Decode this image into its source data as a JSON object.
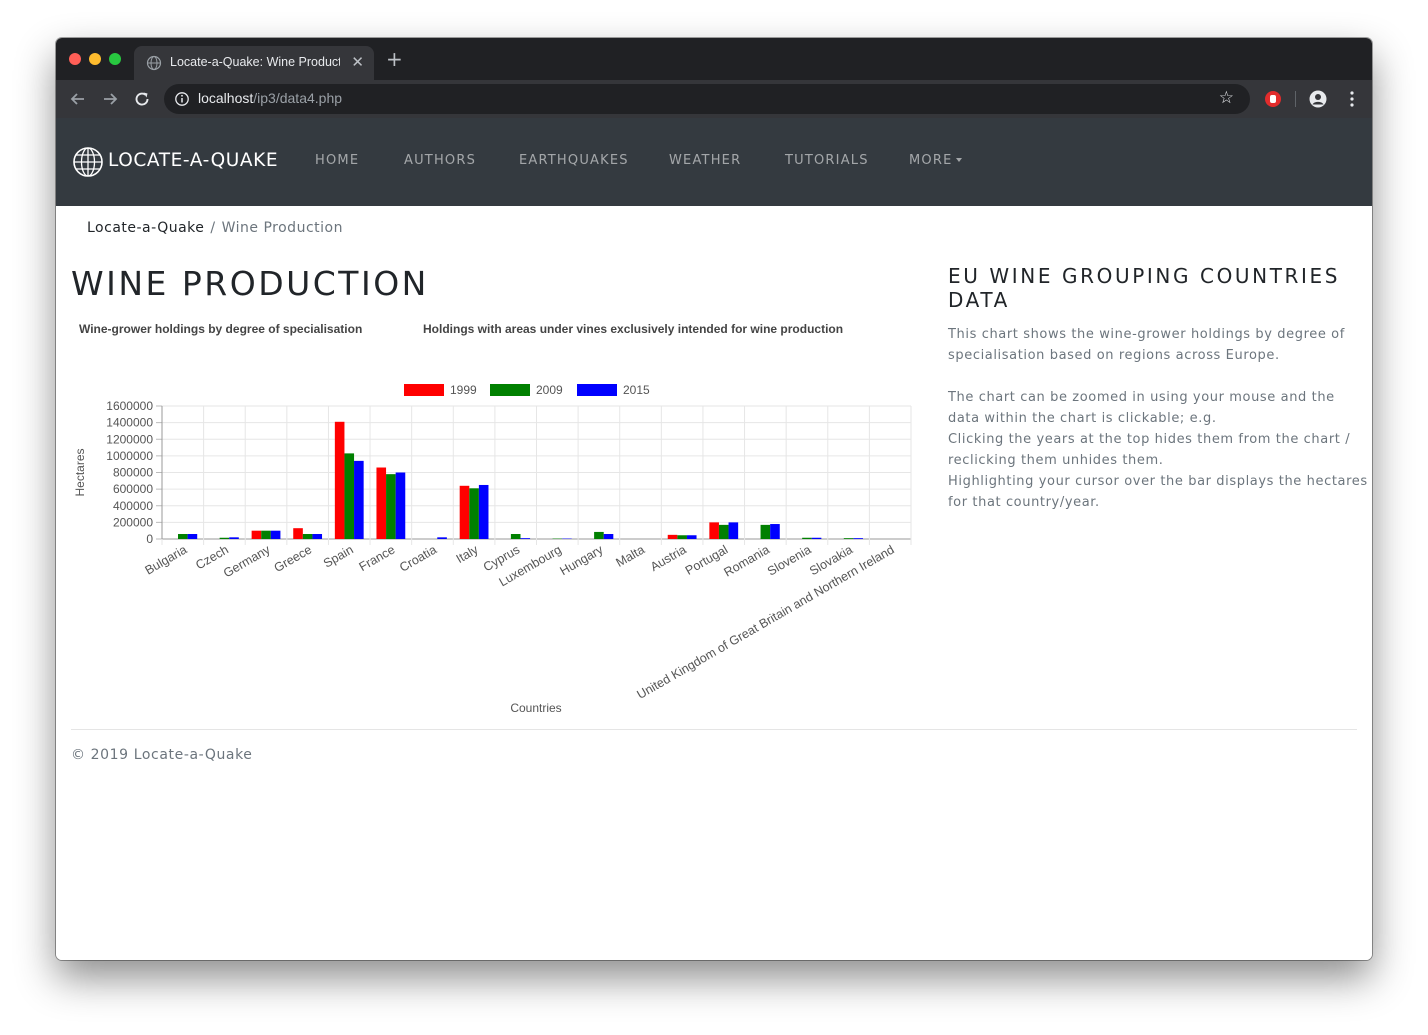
{
  "browser": {
    "tab_title": "Locate-a-Quake: Wine Production",
    "url_host": "localhost",
    "url_path": "/ip3/data4.php"
  },
  "navbar": {
    "brand": "LOCATE-A-QUAKE",
    "links": [
      "HOME",
      "AUTHORS",
      "EARTHQUAKES",
      "WEATHER",
      "TUTORIALS",
      "MORE"
    ]
  },
  "breadcrumb": {
    "home": "Locate-a-Quake",
    "separator": "/",
    "current": "Wine Production"
  },
  "page": {
    "title": "WINE PRODUCTION"
  },
  "chart_data": {
    "type": "bar",
    "title": "Wine-grower holdings by degree of specialisation",
    "subtitle": "Holdings with areas under vines exclusively intended for wine production",
    "xlabel": "Countries",
    "ylabel": "Hectares",
    "ylim": [
      0,
      1600000
    ],
    "yticks": [
      "1600000",
      "1400000",
      "1200000",
      "1000000",
      "800000",
      "600000",
      "400000",
      "200000",
      "0"
    ],
    "grid": true,
    "legend": "top",
    "categories": [
      "Bulgaria",
      "Czech",
      "Germany",
      "Greece",
      "Spain",
      "France",
      "Croatia",
      "Italy",
      "Cyprus",
      "Luxembourg",
      "Hungary",
      "Malta",
      "Austria",
      "Portugal",
      "Romania",
      "Slovenia",
      "Slovakia",
      "United Kingdom of Great Britain and Northern Ireland"
    ],
    "series": [
      {
        "name": "1999",
        "color": "#ff0000",
        "values": [
          0,
          0,
          100000,
          130000,
          1410000,
          860000,
          0,
          640000,
          0,
          0,
          0,
          0,
          50000,
          200000,
          0,
          0,
          0,
          0
        ]
      },
      {
        "name": "2009",
        "color": "#008000",
        "values": [
          60000,
          15000,
          100000,
          60000,
          1030000,
          780000,
          0,
          610000,
          60000,
          5000,
          85000,
          0,
          45000,
          170000,
          170000,
          15000,
          10000,
          0
        ]
      },
      {
        "name": "2015",
        "color": "#0000ff",
        "values": [
          60000,
          20000,
          100000,
          60000,
          940000,
          800000,
          20000,
          650000,
          10000,
          5000,
          60000,
          0,
          45000,
          200000,
          180000,
          15000,
          10000,
          0
        ]
      }
    ]
  },
  "sidebar": {
    "title": "EU WINE GROUPING COUNTRIES DATA",
    "paragraph1": "This chart shows the wine-grower holdings by degree of specialisation based on regions across Europe.",
    "line1": "The chart can be zoomed in using your mouse and the data within the chart is clickable; e.g.",
    "line2": "Clicking the years at the top hides them from the chart / reclicking them unhides them.",
    "line3": "Highlighting your cursor over the bar displays the hectares for that country/year."
  },
  "footer": {
    "text": "© 2019 Locate-a-Quake"
  }
}
